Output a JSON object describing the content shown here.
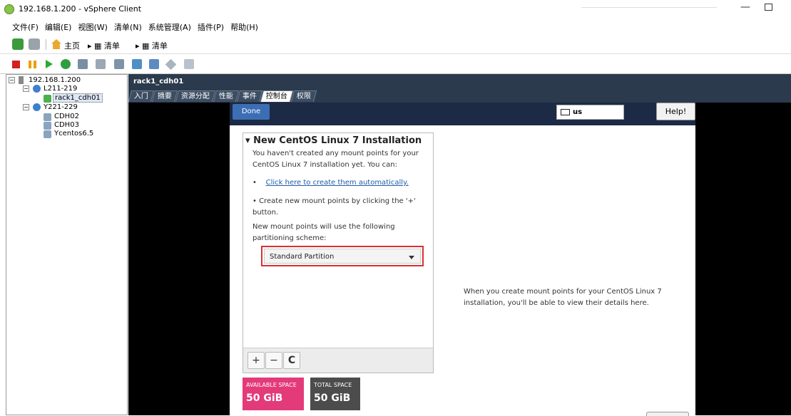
{
  "window": {
    "title": "192.168.1.200 - vSphere Client"
  },
  "menu": [
    "文件(F)",
    "编辑(E)",
    "视图(W)",
    "清单(N)",
    "系统管理(A)",
    "插件(P)",
    "帮助(H)"
  ],
  "nav": {
    "home": "主页",
    "crumb1": "清单",
    "crumb2": "清单"
  },
  "tree": {
    "host": "192.168.1.200",
    "pool1": "L211-219",
    "vm_selected": "rack1_cdh01",
    "pool2": "Y221-229",
    "vm2": "CDH02",
    "vm3": "CDH03",
    "vm4": "Ycentos6.5"
  },
  "console": {
    "vm_title": "rack1_cdh01",
    "tabs": [
      "入门",
      "摘要",
      "资源分配",
      "性能",
      "事件",
      "控制台",
      "权限"
    ],
    "active_tab": "控制台"
  },
  "installer": {
    "done_label": "Done",
    "keyboard": "us",
    "help_label": "Help!",
    "pane_title": "New CentOS Linux 7 Installation",
    "intro": "You haven't created any mount points for your CentOS Linux 7 installation yet.  You can:",
    "auto_link": "Click here to create them automatically.",
    "bullet2": "Create new mount points by clicking the '+' button.",
    "scheme_text": "New mount points will use the following partitioning scheme:",
    "scheme_value": "Standard Partition",
    "add": "+",
    "remove": "−",
    "refresh": "C",
    "available_label": "AVAILABLE SPACE",
    "available_value": "50 GiB",
    "total_label": "TOTAL SPACE",
    "total_value": "50 GiB",
    "right_message": "When you create mount points for your CentOS Linux 7 installation, you'll be able to view their details here."
  },
  "colors": {
    "accent": "#3c6eb4",
    "available": "#e33a7a",
    "highlight": "#d93030"
  }
}
